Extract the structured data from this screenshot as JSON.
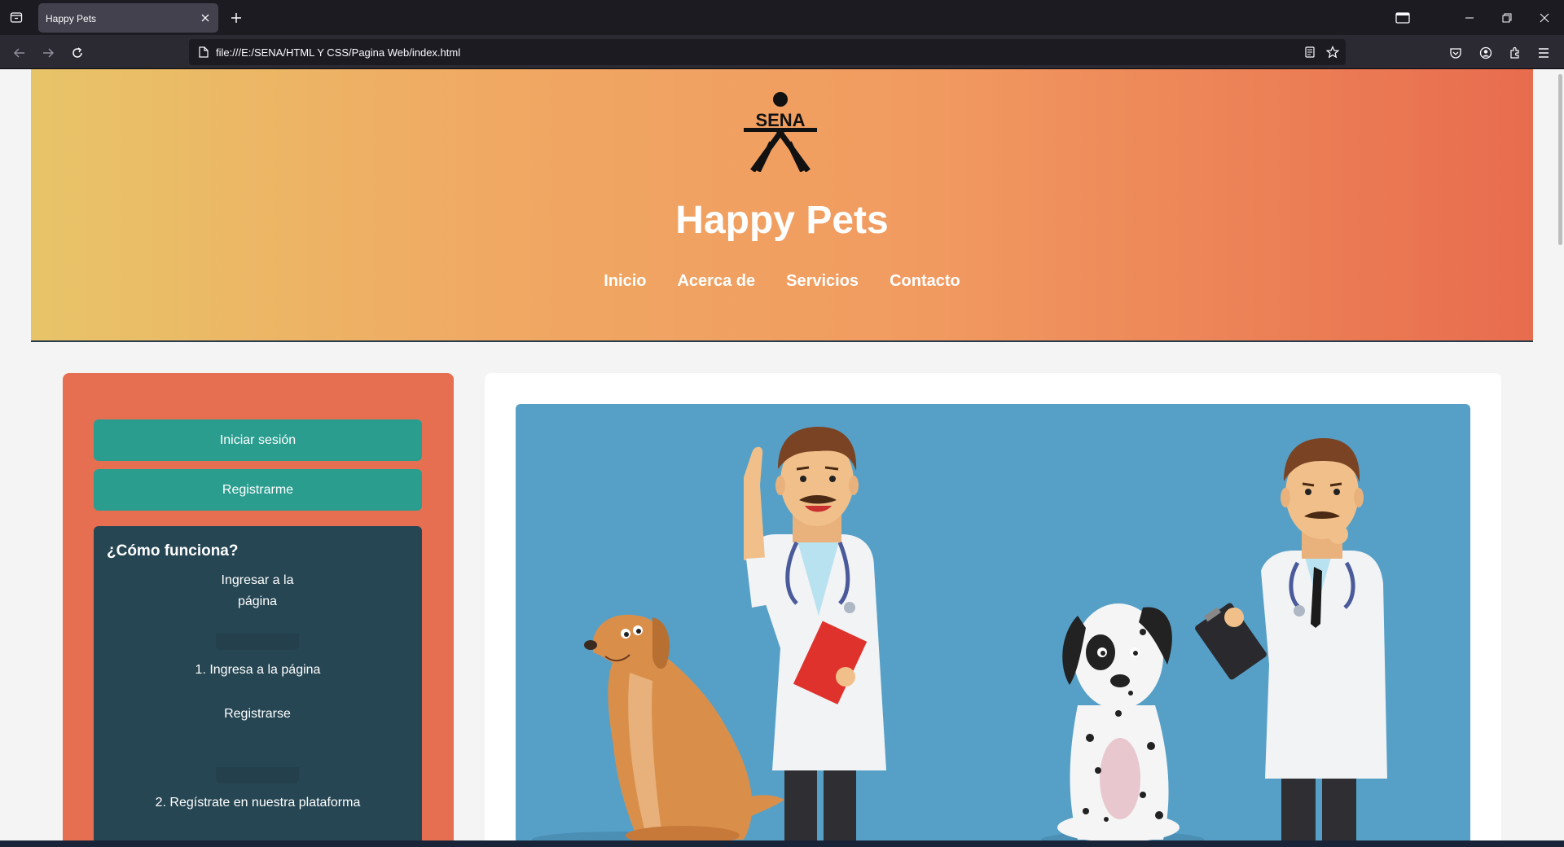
{
  "browser": {
    "tab_title": "Happy Pets",
    "url": "file:///E:/SENA/HTML Y CSS/Pagina Web/index.html"
  },
  "header": {
    "logo_text": "SENA",
    "title": "Happy Pets",
    "nav": [
      "Inicio",
      "Acerca de",
      "Servicios",
      "Contacto"
    ]
  },
  "sidebar": {
    "login_label": "Iniciar sesión",
    "register_label": "Registrarme",
    "how_title": "¿Cómo funciona?",
    "steps": [
      {
        "image_alt": "Ingresar a la página",
        "caption": "1. Ingresa a la página"
      },
      {
        "image_alt": "Registrarse",
        "caption": "2. Regístrate en nuestra plataforma"
      }
    ]
  },
  "colors": {
    "hero_gradient_start": "#e8c468",
    "hero_gradient_end": "#e86c4e",
    "sidebar_bg": "#e76f51",
    "button_bg": "#2a9d8f",
    "how_box_bg": "#264653",
    "illustration_bg": "#56a0c8"
  }
}
